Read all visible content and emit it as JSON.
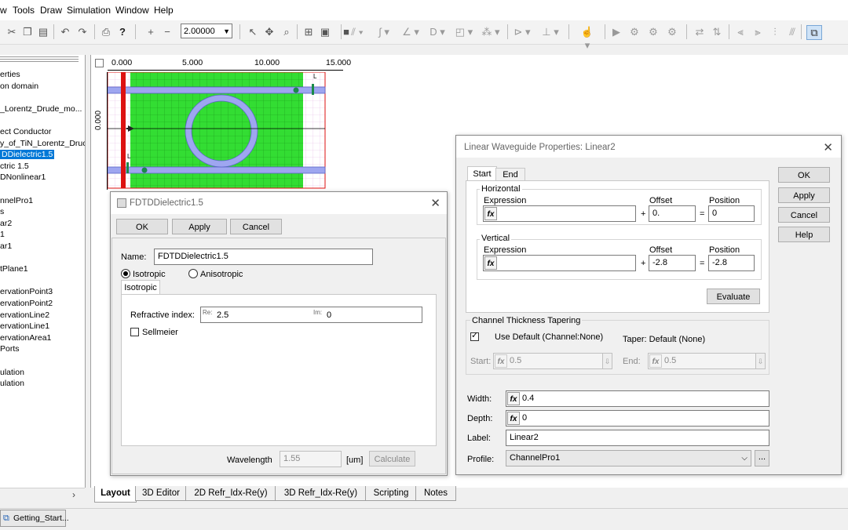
{
  "menubar": {
    "items": [
      "w",
      "Tools",
      "Draw",
      "Simulation",
      "Window",
      "Help"
    ]
  },
  "toolbar": {
    "zoom_value": "2.00000"
  },
  "tree": {
    "items": [
      "erties",
      "on domain",
      "",
      "_Lorentz_Drude_mo...",
      "",
      "ect Conductor",
      "y_of_TiN_Lorentz_Druc",
      "DDielectric1.5",
      "ctric 1.5",
      "DNonlinear1",
      "",
      "nnelPro1",
      "s",
      "ar2",
      "1",
      "ar1",
      "",
      "tPlane1",
      "",
      "ervationPoint3",
      "ervationPoint2",
      "ervationLine2",
      "ervationLine1",
      "ervationArea1",
      " Ports",
      "",
      "ulation",
      "ulation"
    ],
    "selected_index": 7
  },
  "ruler": {
    "x_ticks": [
      "0.000",
      "5.000",
      "10.000",
      "15.000"
    ],
    "y_tick": "0.000"
  },
  "tabs": [
    "Layout",
    "3D Editor",
    "2D Refr_Idx-Re(y)",
    "3D Refr_Idx-Re(y)",
    "Scripting",
    "Notes"
  ],
  "taskbar": {
    "label": "Getting_Start..."
  },
  "colors": {
    "substrate": "#33dd33",
    "waveguide": "#9ea6f0",
    "marker": "#dd1111",
    "selection": "#0078d7"
  },
  "dielectric_dialog": {
    "title": "FDTDDielectric1.5",
    "ok": "OK",
    "apply": "Apply",
    "cancel": "Cancel",
    "name_label": "Name:",
    "name_value": "FDTDDielectric1.5",
    "isotropic": "Isotropic",
    "anisotropic": "Anisotropic",
    "tab": "Isotropic",
    "refr_label": "Refractive index:",
    "re_tag": "Re:",
    "re_value": "2.5",
    "im_tag": "Im:",
    "im_value": "0",
    "sellmeier": "Sellmeier",
    "wavelength_label": "Wavelength",
    "wavelength_value": "1.55",
    "unit": "[um]",
    "calculate": "Calculate"
  },
  "waveguide_dialog": {
    "title": "Linear Waveguide Properties: Linear2",
    "tab_start": "Start",
    "tab_end": "End",
    "horizontal": "Horizontal",
    "vertical": "Vertical",
    "expression": "Expression",
    "offset": "Offset",
    "position": "Position",
    "h_offset": "0.",
    "h_position": "0",
    "v_offset": "-2.8",
    "v_position": "-2.8",
    "plus": "+",
    "equals": "=",
    "evaluate": "Evaluate",
    "tapering": "Channel Thickness Tapering",
    "use_default": "Use Default (Channel:None)",
    "taper": "Taper: Default (None)",
    "start_label": "Start:",
    "start_value": "0.5",
    "end_label": "End:",
    "end_value": "0.5",
    "width_label": "Width:",
    "width_value": "0.4",
    "depth_label": "Depth:",
    "depth_value": "0",
    "label_label": "Label:",
    "label_value": "Linear2",
    "profile_label": "Profile:",
    "profile_value": "ChannelPro1",
    "ok": "OK",
    "apply": "Apply",
    "cancel": "Cancel",
    "help": "Help",
    "more": "..."
  }
}
